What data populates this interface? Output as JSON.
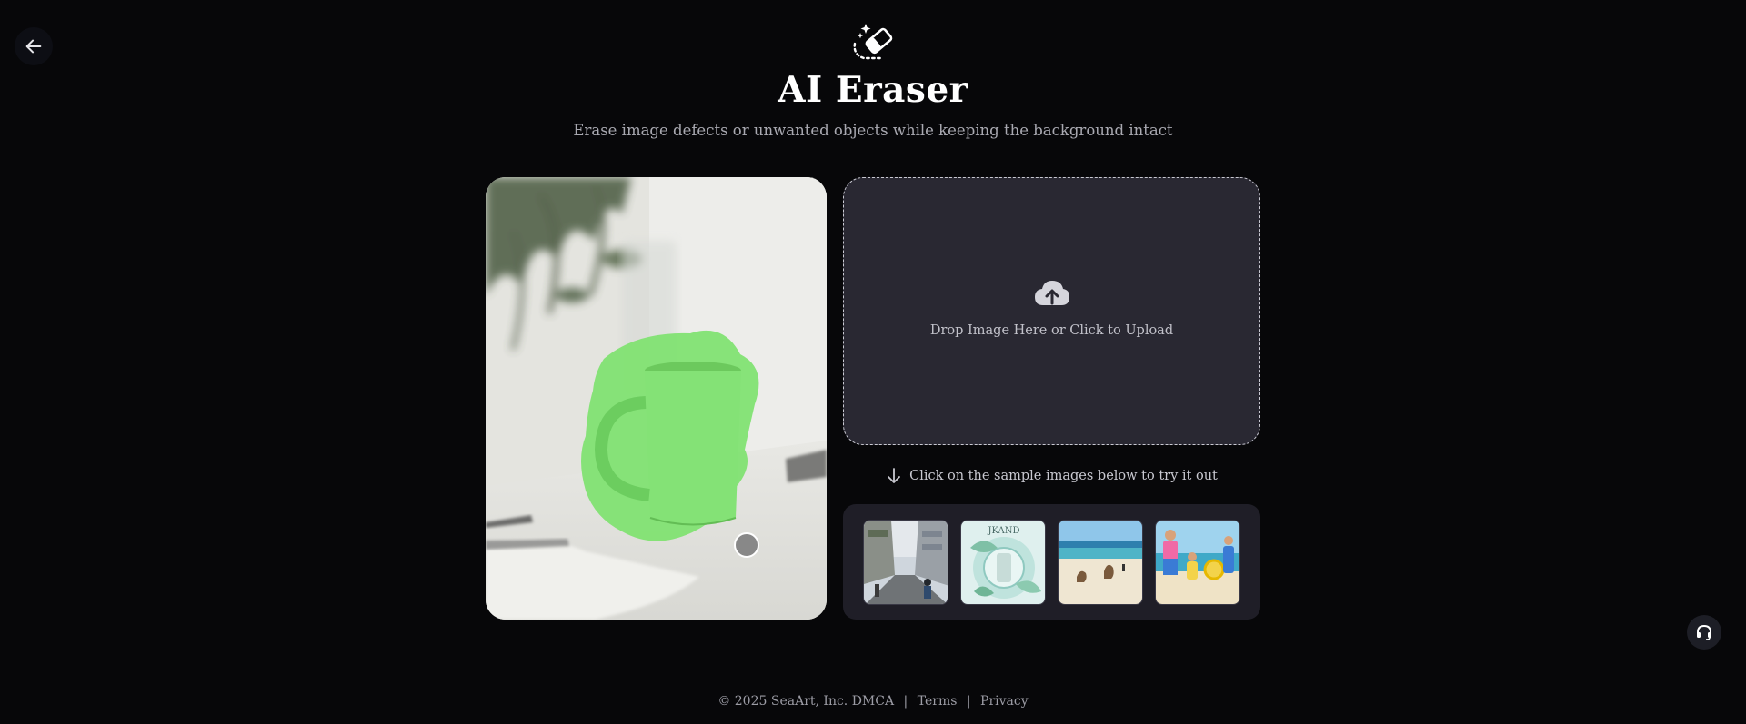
{
  "nav": {
    "back_icon": "arrow-left-icon"
  },
  "header": {
    "icon": "magic-eraser-icon",
    "title": "AI Eraser",
    "subtitle": "Erase image defects or unwanted objects while keeping the background intact"
  },
  "preview": {
    "description_icon": "eraser-demo-image",
    "mask_color": "#7ee26f"
  },
  "upload": {
    "icon": "cloud-upload-icon",
    "label": "Drop Image Here or Click to Upload"
  },
  "samples": {
    "hint_icon": "arrow-down-icon",
    "hint": "Click on the sample images below to try it out",
    "items": [
      {
        "name": "street-scene"
      },
      {
        "name": "skincare-product",
        "label": "JKAND"
      },
      {
        "name": "beach-kangaroos"
      },
      {
        "name": "family-beach"
      }
    ]
  },
  "support": {
    "icon": "headset-icon"
  },
  "footer": {
    "copyright": "© 2025 SeaArt, Inc.",
    "dmca": "DMCA",
    "separator": "|",
    "terms": "Terms",
    "privacy": "Privacy"
  },
  "colors": {
    "background": "#070709",
    "upload_bg": "#292832",
    "panel_bg": "#1f1e27",
    "mask_green": "#7ee26f"
  }
}
